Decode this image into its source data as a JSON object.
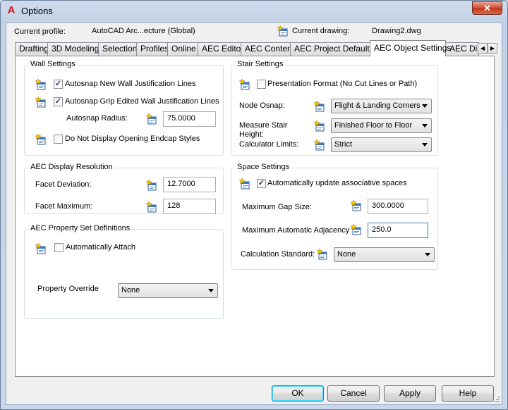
{
  "window": {
    "title": "Options",
    "app_icon": "A",
    "close_glyph": "✕"
  },
  "header": {
    "current_profile_label": "Current profile:",
    "current_profile_value": "AutoCAD Arc...ecture (Global)",
    "current_drawing_label": "Current drawing:",
    "current_drawing_value": "Drawing2.dwg"
  },
  "tabs": [
    "Drafting",
    "3D Modeling",
    "Selection",
    "Profiles",
    "Online",
    "AEC Editor",
    "AEC Content",
    "AEC Project Defaults",
    "AEC Object Settings",
    "AEC Dim"
  ],
  "active_tab": "AEC Object Settings",
  "wall_settings": {
    "title": "Wall Settings",
    "autosnap_new_label": "Autosnap New Wall Justification Lines",
    "autosnap_new_checked": true,
    "autosnap_grip_label": "Autosnap Grip Edited Wall Justification Lines",
    "autosnap_grip_checked": true,
    "autosnap_radius_label": "Autosnap Radius:",
    "autosnap_radius_value": "75.0000",
    "endcap_label": "Do Not Display Opening Endcap Styles",
    "endcap_checked": false
  },
  "display_resolution": {
    "title": "AEC Display Resolution",
    "facet_deviation_label": "Facet Deviation:",
    "facet_deviation_value": "12.7000",
    "facet_maximum_label": "Facet Maximum:",
    "facet_maximum_value": "128"
  },
  "property_sets": {
    "title": "AEC Property Set Definitions",
    "auto_attach_label": "Automatically Attach",
    "auto_attach_checked": false,
    "override_label": "Property Override",
    "override_value": "None"
  },
  "stair_settings": {
    "title": "Stair Settings",
    "presentation_label": "Presentation Format (No Cut Lines or Path)",
    "presentation_checked": false,
    "node_osnap_label": "Node Osnap:",
    "node_osnap_value": "Flight & Landing Corners",
    "measure_height_label_1": "Measure Stair",
    "measure_height_label_2": "Height:",
    "measure_height_value": "Finished Floor to Floor",
    "calc_limits_label": "Calculator Limits:",
    "calc_limits_value": "Strict"
  },
  "space_settings": {
    "title": "Space Settings",
    "auto_update_label": "Automatically update associative spaces",
    "auto_update_checked": true,
    "max_gap_label": "Maximum Gap Size:",
    "max_gap_value": "300.0000",
    "max_adjacency_label": "Maximum Automatic Adjacency",
    "max_adjacency_value": "250.0",
    "calc_standard_label": "Calculation Standard:",
    "calc_standard_value": "None"
  },
  "buttons": {
    "ok": "OK",
    "cancel": "Cancel",
    "apply": "Apply",
    "help": "Help"
  },
  "icons": {
    "drawing_icon": "drawing-settings-icon",
    "check_glyph": "✓"
  },
  "colors": {
    "accent": "#3c7fb1",
    "close": "#c23216",
    "panel": "#ffffff"
  }
}
